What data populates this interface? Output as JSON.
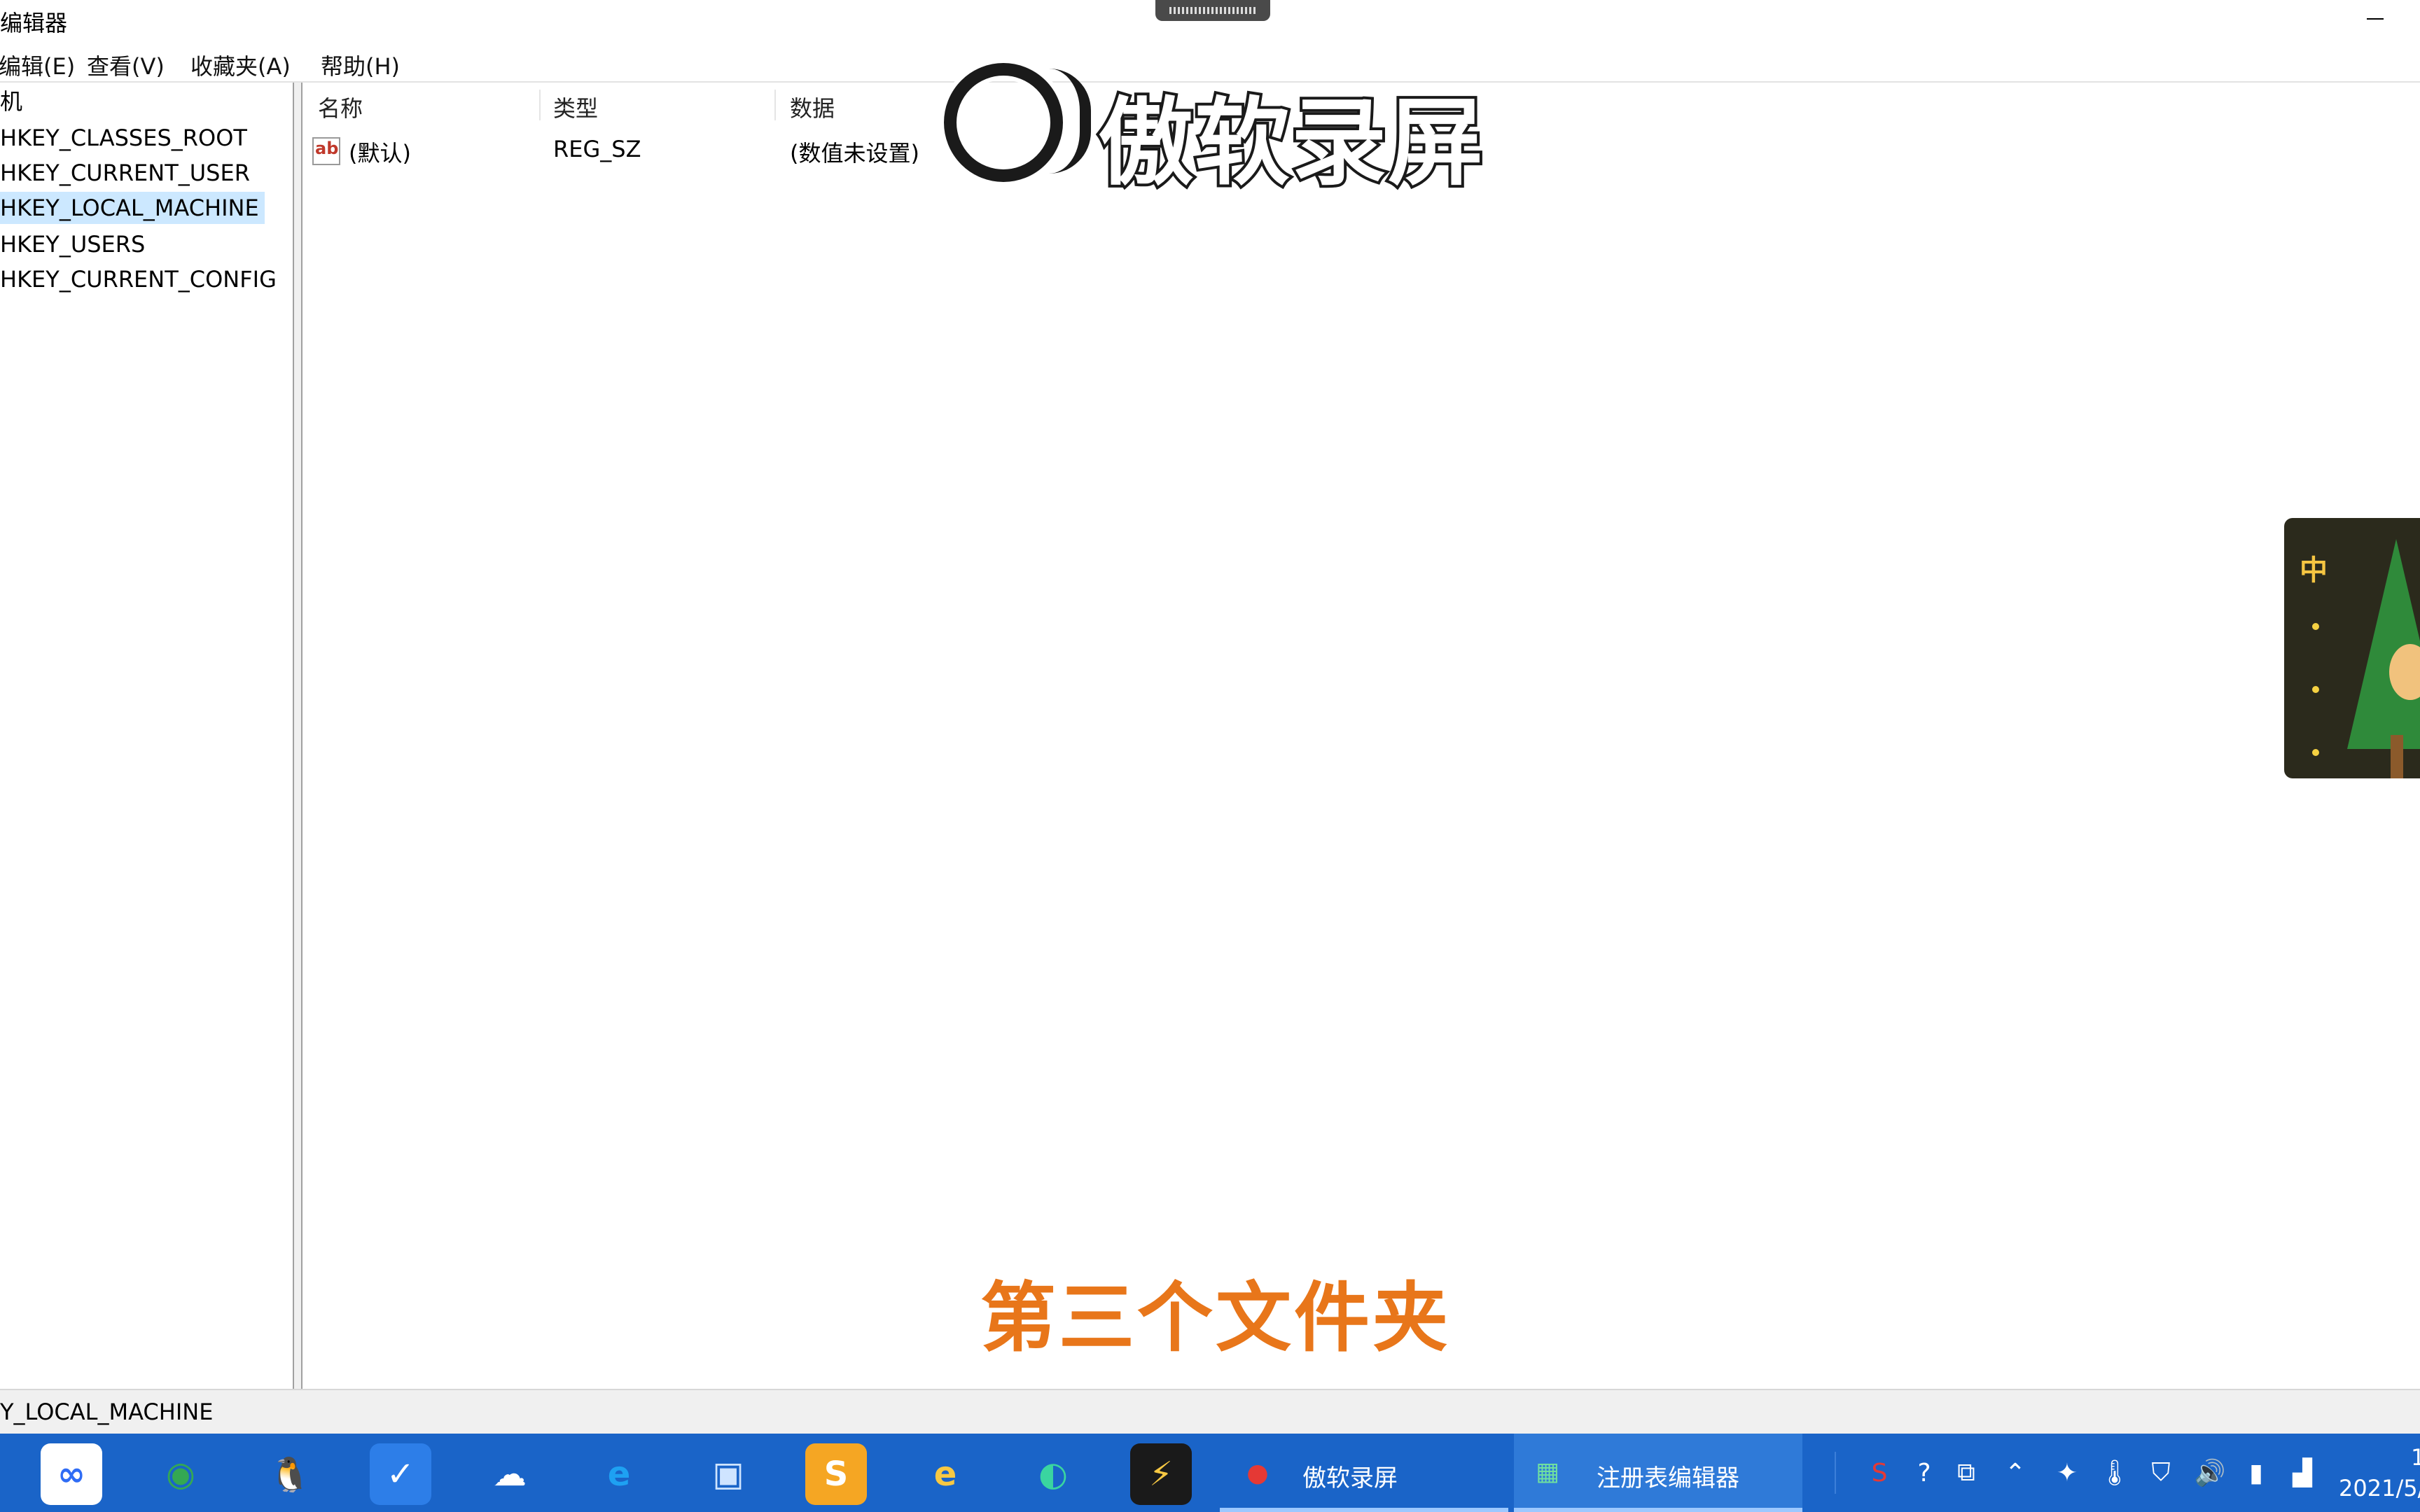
{
  "window": {
    "title": "编辑器"
  },
  "menu": {
    "items": [
      "编辑(E)",
      "查看(V)",
      "收藏夹(A)",
      "帮助(H)"
    ]
  },
  "tree": {
    "root_label": "机",
    "items": [
      "HKEY_CLASSES_ROOT",
      "HKEY_CURRENT_USER",
      "HKEY_LOCAL_MACHINE",
      "HKEY_USERS",
      "HKEY_CURRENT_CONFIG"
    ],
    "selected": "HKEY_LOCAL_MACHINE"
  },
  "list": {
    "columns": [
      "名称",
      "类型",
      "数据"
    ],
    "rows": [
      {
        "icon": "ab",
        "name": "(默认)",
        "type": "REG_SZ",
        "data": "(数值未设置)"
      }
    ]
  },
  "watermark": {
    "text": "傲软录屏"
  },
  "subtitle": "第三个文件夹",
  "widget": {
    "char": "中"
  },
  "status": {
    "path": "Y_LOCAL_MACHINE"
  },
  "taskbar": {
    "apps": [
      {
        "name": "baidu-netdisk-icon",
        "glyph": "∞",
        "bg": "#ffffff",
        "color": "#2f6cf5"
      },
      {
        "name": "chrome-icon",
        "glyph": "◉",
        "bg": "transparent",
        "color": "#34a853"
      },
      {
        "name": "qq-icon",
        "glyph": "🐧",
        "bg": "transparent",
        "color": "#000000"
      },
      {
        "name": "tencent-shield-icon",
        "glyph": "✓",
        "bg": "#2d7ee8",
        "color": "#ffffff"
      },
      {
        "name": "cloud-app-icon",
        "glyph": "☁",
        "bg": "transparent",
        "color": "#ffffff"
      },
      {
        "name": "ie-icon",
        "glyph": "e",
        "bg": "transparent",
        "color": "#1ea1f2"
      },
      {
        "name": "remote-desktop-icon",
        "glyph": "▣",
        "bg": "transparent",
        "color": "#cfe4ff"
      },
      {
        "name": "notes-app-icon",
        "glyph": "S",
        "bg": "#f5a623",
        "color": "#ffffff"
      },
      {
        "name": "internet-explorer-icon",
        "glyph": "e",
        "bg": "transparent",
        "color": "#f7c843"
      },
      {
        "name": "edge-icon",
        "glyph": "◐",
        "bg": "transparent",
        "color": "#3ad5a0"
      },
      {
        "name": "thunder-icon",
        "glyph": "⚡",
        "bg": "#1a1a1a",
        "color": "#f7c843"
      }
    ],
    "running": [
      {
        "label": "傲软录屏",
        "active": false
      },
      {
        "label": "注册表编辑器",
        "active": true
      }
    ],
    "tray": [
      "sogou-icon",
      "help-icon",
      "window-restore-icon",
      "chevron-up-icon",
      "network-icon",
      "thermometer-icon",
      "shield-icon",
      "volume-icon",
      "battery-icon",
      "signal-icon"
    ],
    "clock": {
      "time": "1",
      "date": "2021/5/"
    }
  }
}
